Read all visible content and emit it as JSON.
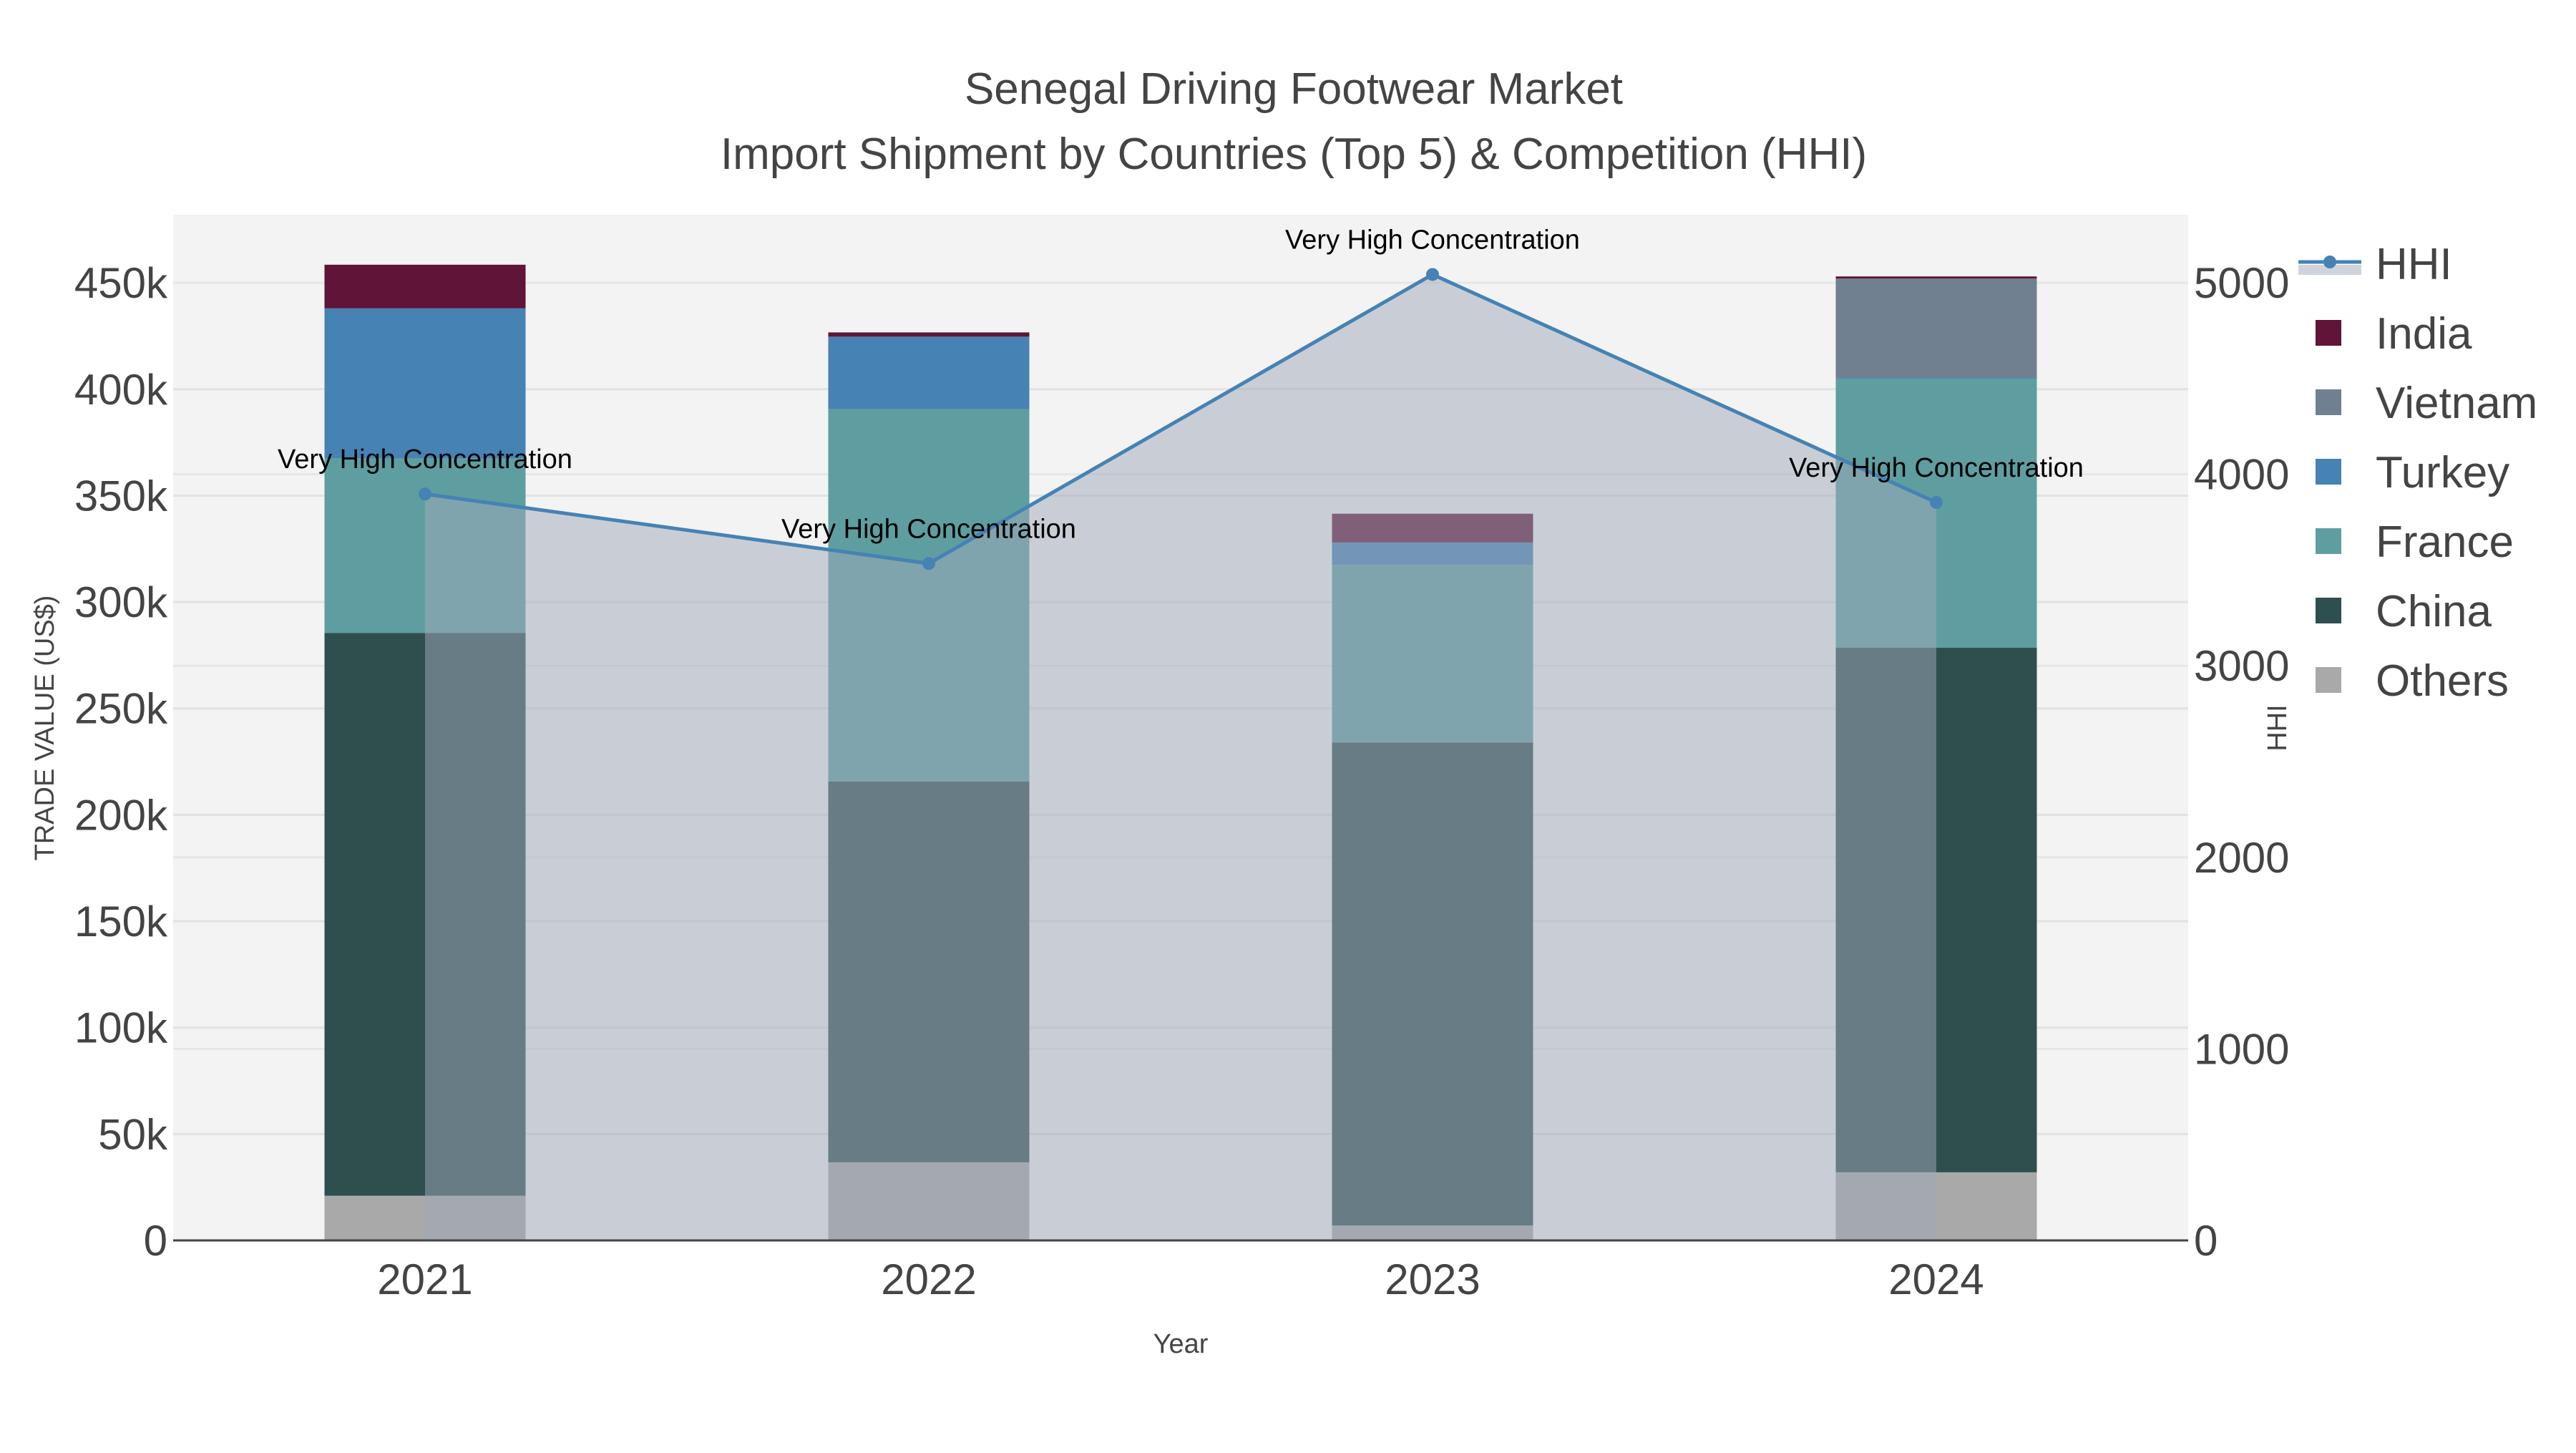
{
  "chart_data": {
    "type": "bar",
    "title": "Senegal Driving Footwear Market",
    "subtitle": "Import Shipment by Countries (Top 5) & Competition (HHI)",
    "xlabel": "Year",
    "ylabel": "TRADE VALUE (US$)",
    "y2label": "HHI",
    "categories": [
      "2021",
      "2022",
      "2023",
      "2024"
    ],
    "ylim": [
      0,
      482000
    ],
    "y2lim": [
      0,
      5355
    ],
    "yticks": [
      0,
      50000,
      100000,
      150000,
      200000,
      250000,
      300000,
      350000,
      400000,
      450000
    ],
    "ytick_labels": [
      "0",
      "50k",
      "100k",
      "150k",
      "200k",
      "250k",
      "300k",
      "350k",
      "400k",
      "450k"
    ],
    "y2ticks": [
      0,
      1000,
      2000,
      3000,
      4000,
      5000
    ],
    "y2tick_labels": [
      "0",
      "1000",
      "2000",
      "3000",
      "4000",
      "5000"
    ],
    "grid": true,
    "legend_placement": "right",
    "series": [
      {
        "name": "Others",
        "color": "#a9a9a9",
        "values": [
          21000,
          36700,
          7000,
          32000
        ]
      },
      {
        "name": "China",
        "color": "#2f4f4f",
        "values": [
          264500,
          179000,
          227000,
          246500
        ]
      },
      {
        "name": "France",
        "color": "#5f9ea0",
        "values": [
          82000,
          175000,
          83500,
          126500
        ]
      },
      {
        "name": "Turkey",
        "color": "#4682b4",
        "values": [
          70500,
          34000,
          10500,
          500
        ]
      },
      {
        "name": "Vietnam",
        "color": "#708090",
        "values": [
          0,
          0,
          0,
          46500
        ]
      },
      {
        "name": "India",
        "color": "#601437",
        "values": [
          20500,
          2000,
          13500,
          1000
        ]
      }
    ],
    "line_series": {
      "name": "HHI",
      "color": "#4682b4",
      "fill": "#a0aab9",
      "axis": "right",
      "values": [
        3897,
        3534,
        5043,
        3853
      ]
    },
    "annotations": [
      "Very High Concentration",
      "Very High Concentration",
      "Very High Concentration",
      "Very High Concentration"
    ],
    "legend": [
      "HHI",
      "India",
      "Vietnam",
      "Turkey",
      "France",
      "China",
      "Others"
    ]
  }
}
